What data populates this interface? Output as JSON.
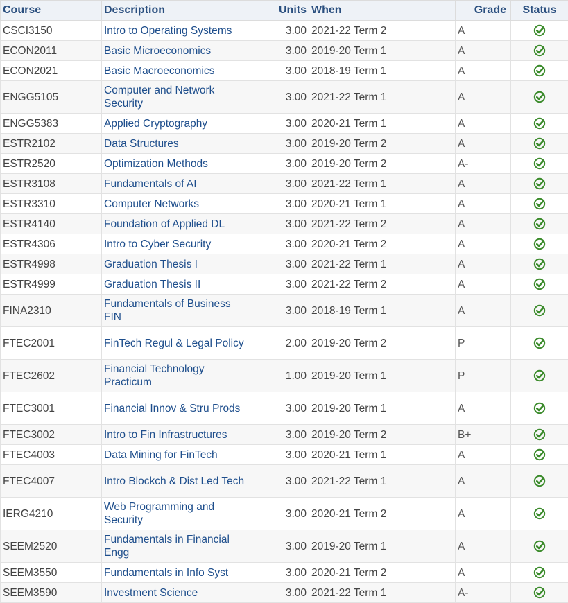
{
  "headers": {
    "course": "Course",
    "description": "Description",
    "units": "Units",
    "when": "When",
    "grade": "Grade",
    "status": "Status"
  },
  "status_icon": "check-circle-icon",
  "colors": {
    "header_text": "#2a4f7f",
    "link": "#1e4e8c",
    "check": "#3a8a2a"
  },
  "rows": [
    {
      "course": "CSCI3150",
      "description": "Intro to Operating Systems",
      "units": "3.00",
      "when": "2021-22 Term 2",
      "grade": "A",
      "lines": 1
    },
    {
      "course": "ECON2011",
      "description": "Basic Microeconomics",
      "units": "3.00",
      "when": "2019-20 Term 1",
      "grade": "A",
      "lines": 1
    },
    {
      "course": "ECON2021",
      "description": "Basic Macroeconomics",
      "units": "3.00",
      "when": "2018-19 Term 1",
      "grade": "A",
      "lines": 1
    },
    {
      "course": "ENGG5105",
      "description": "Computer and Network Security",
      "units": "3.00",
      "when": "2021-22 Term 1",
      "grade": "A",
      "lines": 2
    },
    {
      "course": "ENGG5383",
      "description": "Applied Cryptography",
      "units": "3.00",
      "when": "2020-21 Term 1",
      "grade": "A",
      "lines": 1
    },
    {
      "course": "ESTR2102",
      "description": "Data Structures",
      "units": "3.00",
      "when": "2019-20 Term 2",
      "grade": "A",
      "lines": 1
    },
    {
      "course": "ESTR2520",
      "description": "Optimization Methods",
      "units": "3.00",
      "when": "2019-20 Term 2",
      "grade": "A-",
      "lines": 1
    },
    {
      "course": "ESTR3108",
      "description": "Fundamentals of AI",
      "units": "3.00",
      "when": "2021-22 Term 1",
      "grade": "A",
      "lines": 1
    },
    {
      "course": "ESTR3310",
      "description": "Computer Networks",
      "units": "3.00",
      "when": "2020-21 Term 1",
      "grade": "A",
      "lines": 1
    },
    {
      "course": "ESTR4140",
      "description": "Foundation of Applied DL",
      "units": "3.00",
      "when": "2021-22 Term 2",
      "grade": "A",
      "lines": 1
    },
    {
      "course": "ESTR4306",
      "description": "Intro to Cyber Security",
      "units": "3.00",
      "when": "2020-21 Term 2",
      "grade": "A",
      "lines": 1
    },
    {
      "course": "ESTR4998",
      "description": "Graduation Thesis I",
      "units": "3.00",
      "when": "2021-22 Term 1",
      "grade": "A",
      "lines": 1
    },
    {
      "course": "ESTR4999",
      "description": "Graduation Thesis II",
      "units": "3.00",
      "when": "2021-22 Term 2",
      "grade": "A",
      "lines": 1
    },
    {
      "course": "FINA2310",
      "description": "Fundamentals of Business FIN",
      "units": "3.00",
      "when": "2018-19 Term 1",
      "grade": "A",
      "lines": 2
    },
    {
      "course": "FTEC2001",
      "description": "FinTech Regul & Legal Policy",
      "units": "2.00",
      "when": "2019-20 Term 2",
      "grade": "P",
      "lines": 2
    },
    {
      "course": "FTEC2602",
      "description": "Financial Technology Practicum",
      "units": "1.00",
      "when": "2019-20 Term 1",
      "grade": "P",
      "lines": 2
    },
    {
      "course": "FTEC3001",
      "description": "Financial Innov & Stru Prods",
      "units": "3.00",
      "when": "2019-20 Term 1",
      "grade": "A",
      "lines": 2
    },
    {
      "course": "FTEC3002",
      "description": "Intro to Fin Infrastructures",
      "units": "3.00",
      "when": "2019-20 Term 2",
      "grade": "B+",
      "lines": 1
    },
    {
      "course": "FTEC4003",
      "description": "Data Mining for FinTech",
      "units": "3.00",
      "when": "2020-21 Term 1",
      "grade": "A",
      "lines": 1
    },
    {
      "course": "FTEC4007",
      "description": "Intro Blockch & Dist Led Tech",
      "units": "3.00",
      "when": "2021-22 Term 1",
      "grade": "A",
      "lines": 2
    },
    {
      "course": "IERG4210",
      "description": "Web Programming and Security",
      "units": "3.00",
      "when": "2020-21 Term 2",
      "grade": "A",
      "lines": 2
    },
    {
      "course": "SEEM2520",
      "description": "Fundamentals in Financial Engg",
      "units": "3.00",
      "when": "2019-20 Term 1",
      "grade": "A",
      "lines": 2
    },
    {
      "course": "SEEM3550",
      "description": "Fundamentals in Info Syst",
      "units": "3.00",
      "when": "2020-21 Term 2",
      "grade": "A",
      "lines": 1
    },
    {
      "course": "SEEM3590",
      "description": "Investment Science",
      "units": "3.00",
      "when": "2021-22 Term 1",
      "grade": "A-",
      "lines": 1
    }
  ]
}
